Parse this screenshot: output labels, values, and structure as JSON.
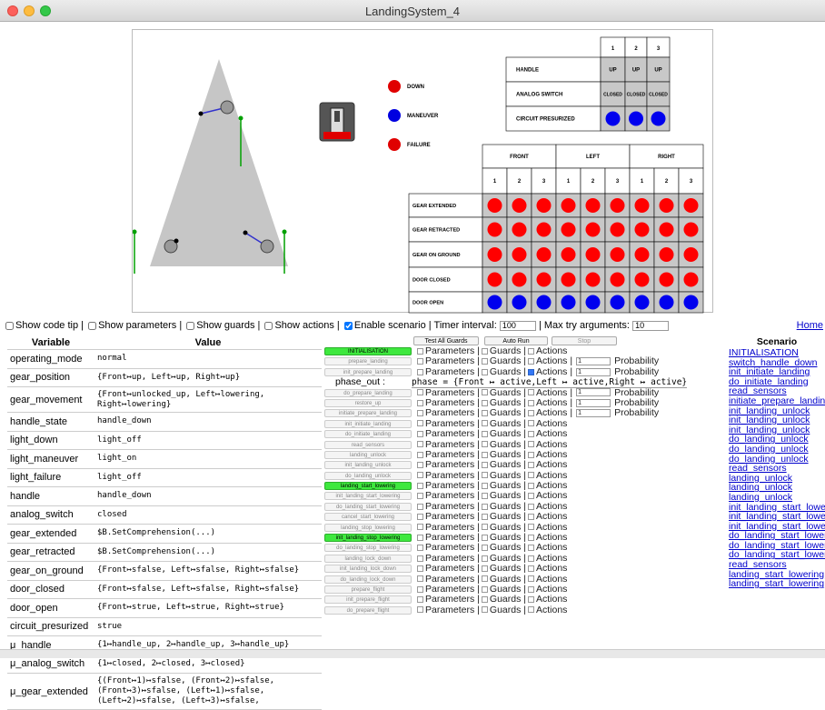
{
  "window": {
    "title": "LandingSystem_4"
  },
  "canvas": {
    "indicators": [
      {
        "label": "DOWN",
        "color": "#e00000"
      },
      {
        "label": "MANEUVER",
        "color": "#0000e0"
      },
      {
        "label": "FAILURE",
        "color": "#e00000"
      }
    ],
    "top_table": {
      "columns": [
        "1",
        "2",
        "3"
      ],
      "rows": [
        {
          "label": "HANDLE",
          "cells": [
            "UP",
            "UP",
            "UP"
          ]
        },
        {
          "label": "ANALOG SWITCH",
          "cells": [
            "CLOSED",
            "CLOSED",
            "CLOSED"
          ]
        },
        {
          "label": "CIRCUIT PRESURIZED",
          "cells": [
            "blue",
            "blue",
            "blue"
          ]
        }
      ]
    },
    "gear_table": {
      "groups": [
        "FRONT",
        "LEFT",
        "RIGHT"
      ],
      "subcolumns": [
        "1",
        "2",
        "3"
      ],
      "rows": [
        {
          "label": "GEAR EXTENDED",
          "color": "red"
        },
        {
          "label": "GEAR RETRACTED",
          "color": "red"
        },
        {
          "label": "GEAR ON GROUND",
          "color": "red"
        },
        {
          "label": "DOOR CLOSED",
          "color": "red"
        },
        {
          "label": "DOOR OPEN",
          "color": "blue"
        }
      ]
    }
  },
  "controls": {
    "show_code_tip": "Show code tip |",
    "show_parameters": "Show parameters |",
    "show_guards": "Show guards |",
    "show_actions": "Show actions |",
    "enable_scenario": "Enable scenario |",
    "timer_label": "Timer interval:",
    "timer_value": "100",
    "max_try_label": "| Max try arguments:",
    "max_try_value": "10",
    "home": "Home"
  },
  "variables": {
    "header_variable": "Variable",
    "header_value": "Value",
    "rows": [
      {
        "name": "operating_mode",
        "value": "normal"
      },
      {
        "name": "gear_position",
        "value": "{Front↦up, Left↦up, Right↦up}"
      },
      {
        "name": "gear_movement",
        "value": "{Front↦unlocked_up, Left↦lowering, Right↦lowering}"
      },
      {
        "name": "handle_state",
        "value": "handle_down"
      },
      {
        "name": "light_down",
        "value": "light_off"
      },
      {
        "name": "light_maneuver",
        "value": "light_on"
      },
      {
        "name": "light_failure",
        "value": "light_off"
      },
      {
        "name": "handle",
        "value": "handle_down"
      },
      {
        "name": "analog_switch",
        "value": "closed"
      },
      {
        "name": "gear_extended",
        "value": "$B.SetComprehension(...)"
      },
      {
        "name": "gear_retracted",
        "value": "$B.SetComprehension(...)"
      },
      {
        "name": "gear_on_ground",
        "value": "{Front↦sfalse, Left↦sfalse, Right↦sfalse}"
      },
      {
        "name": "door_closed",
        "value": "{Front↦sfalse, Left↦sfalse, Right↦sfalse}"
      },
      {
        "name": "door_open",
        "value": "{Front↦strue, Left↦strue, Right↦strue}"
      },
      {
        "name": "circuit_presurized",
        "value": "strue"
      },
      {
        "name": "μ_handle",
        "value": "{1↦handle_up, 2↦handle_up, 3↦handle_up}"
      },
      {
        "name": "μ_analog_switch",
        "value": "{1↦closed, 2↦closed, 3↦closed}"
      },
      {
        "name": "μ_gear_extended",
        "value": "{(Front↦1)↦sfalse, (Front↦2)↦sfalse, (Front↦3)↦sfalse, (Left↦1)↦sfalse, (Left↦2)↦sfalse, (Left↦3)↦sfalse,"
      }
    ]
  },
  "operations": {
    "top_buttons": [
      "Test All Guards",
      "Auto Run",
      "Stop"
    ],
    "parameters_label": "Parameters |",
    "guards_label": "Guards |",
    "actions_label": "Actions",
    "probability_label": "Probability",
    "phase_label": "phase_out :",
    "phase_value": "phase = {Front ↦ active,Left ↦ active,Right ↦ active}",
    "items": [
      {
        "name": "INITIALISATION",
        "enabled": true,
        "actions_checked": false,
        "prob": null
      },
      {
        "name": "prepare_landing",
        "enabled": false,
        "actions_checked": false,
        "prob": "1"
      },
      {
        "name": "init_prepare_landing",
        "enabled": false,
        "actions_checked": true,
        "prob": "1"
      },
      {
        "phase": true
      },
      {
        "name": "do_prepare_landing",
        "enabled": false,
        "actions_checked": false,
        "prob": "1"
      },
      {
        "name": "restore_up",
        "enabled": false,
        "actions_checked": false,
        "prob": "1"
      },
      {
        "name": "initiate_prepare_landing",
        "enabled": false,
        "actions_checked": false,
        "prob": "1"
      },
      {
        "name": "init_initiate_landing",
        "enabled": false,
        "actions_checked": false,
        "prob": null
      },
      {
        "name": "do_initiate_landing",
        "enabled": false,
        "actions_checked": false,
        "prob": null
      },
      {
        "name": "read_sensors",
        "enabled": false,
        "actions_checked": false,
        "prob": null
      },
      {
        "name": "landing_unlock",
        "enabled": false,
        "actions_checked": false,
        "prob": null
      },
      {
        "name": "init_landing_unlock",
        "enabled": false,
        "actions_checked": false,
        "prob": null
      },
      {
        "name": "do_landing_unlock",
        "enabled": false,
        "actions_checked": false,
        "prob": null
      },
      {
        "name": "landing_start_lowering",
        "enabled": true,
        "actions_checked": false,
        "prob": null
      },
      {
        "name": "init_landing_start_lowering",
        "enabled": false,
        "actions_checked": false,
        "prob": null
      },
      {
        "name": "do_landing_start_lowering",
        "enabled": false,
        "actions_checked": false,
        "prob": null
      },
      {
        "name": "cancel_start_lowering",
        "enabled": false,
        "actions_checked": false,
        "prob": null
      },
      {
        "name": "landing_stop_lowering",
        "enabled": false,
        "actions_checked": false,
        "prob": null
      },
      {
        "name": "init_landing_stop_lowering",
        "enabled": true,
        "actions_checked": false,
        "prob": null
      },
      {
        "name": "do_landing_stop_lowering",
        "enabled": false,
        "actions_checked": false,
        "prob": null
      },
      {
        "name": "landing_lock_down",
        "enabled": false,
        "actions_checked": false,
        "prob": null
      },
      {
        "name": "init_landing_lock_down",
        "enabled": false,
        "actions_checked": false,
        "prob": null
      },
      {
        "name": "do_landing_lock_down",
        "enabled": false,
        "actions_checked": false,
        "prob": null
      },
      {
        "name": "prepare_flight",
        "enabled": false,
        "actions_checked": false,
        "prob": null
      },
      {
        "name": "init_prepare_flight",
        "enabled": false,
        "actions_checked": false,
        "prob": null
      },
      {
        "name": "do_prepare_flight",
        "enabled": false,
        "actions_checked": false,
        "prob": null
      }
    ]
  },
  "scenario": {
    "header": "Scenario",
    "items": [
      "INITIALISATION",
      "switch_handle_down",
      "init_initiate_landing",
      "do_initiate_landing",
      "read_sensors",
      "initiate_prepare_landing",
      "init_landing_unlock",
      "init_landing_unlock",
      "init_landing_unlock",
      "do_landing_unlock",
      "do_landing_unlock",
      "do_landing_unlock",
      "read_sensors",
      "landing_unlock",
      "landing_unlock",
      "landing_unlock",
      "init_landing_start_loweri",
      "init_landing_start_loweri",
      "init_landing_start_loweri",
      "do_landing_start_lowerin",
      "do_landing_start_lowerin",
      "do_landing_start_lowerin",
      "read_sensors",
      "landing_start_lowering",
      "landing_start_lowering"
    ]
  },
  "colors": {
    "red": "#ff0000",
    "blue": "#0000ee",
    "enabled": "#3ee83e",
    "gear_line": "#00a000",
    "cell_bg": "#c8c8c8"
  }
}
